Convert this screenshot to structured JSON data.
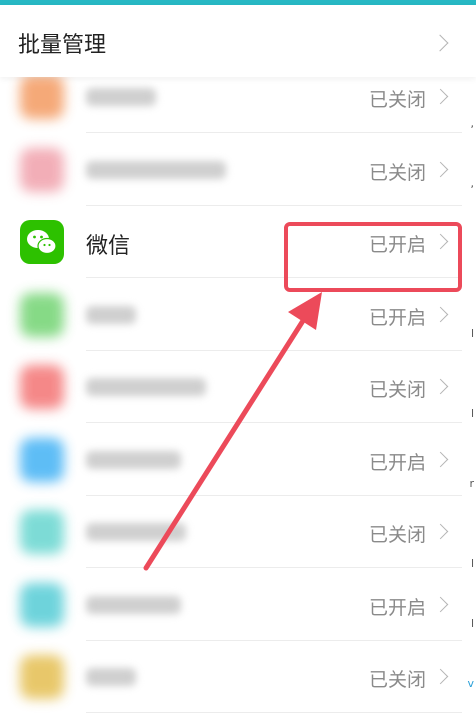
{
  "header": {
    "title": "批量管理"
  },
  "rows": [
    {
      "name": "",
      "status": "已关闭",
      "blur": true,
      "icon_color": "#f4a06a",
      "label_width": 70
    },
    {
      "name": "",
      "status": "已关闭",
      "blur": true,
      "icon_color": "#f1a6b0",
      "label_width": 140
    },
    {
      "name": "微信",
      "status": "已开启",
      "blur": false,
      "icon": "wechat-icon",
      "icon_color": "#2dc100"
    },
    {
      "name": "",
      "status": "已开启",
      "blur": true,
      "icon_color": "#7ad67a",
      "label_width": 50
    },
    {
      "name": "",
      "status": "已关闭",
      "blur": true,
      "icon_color": "#f47c7c",
      "label_width": 120
    },
    {
      "name": "",
      "status": "已开启",
      "blur": true,
      "icon_color": "#4db6f5",
      "label_width": 95
    },
    {
      "name": "",
      "status": "已关闭",
      "blur": true,
      "icon_color": "#6fd8d2",
      "label_width": 100
    },
    {
      "name": "",
      "status": "已开启",
      "blur": true,
      "icon_color": "#5fcfd8",
      "label_width": 95
    },
    {
      "name": "",
      "status": "已关闭",
      "blur": true,
      "icon_color": "#e6c25a",
      "label_width": 50
    }
  ],
  "colors": {
    "accent_bar": "#27b8c4",
    "highlight": "#ec4a5a"
  }
}
